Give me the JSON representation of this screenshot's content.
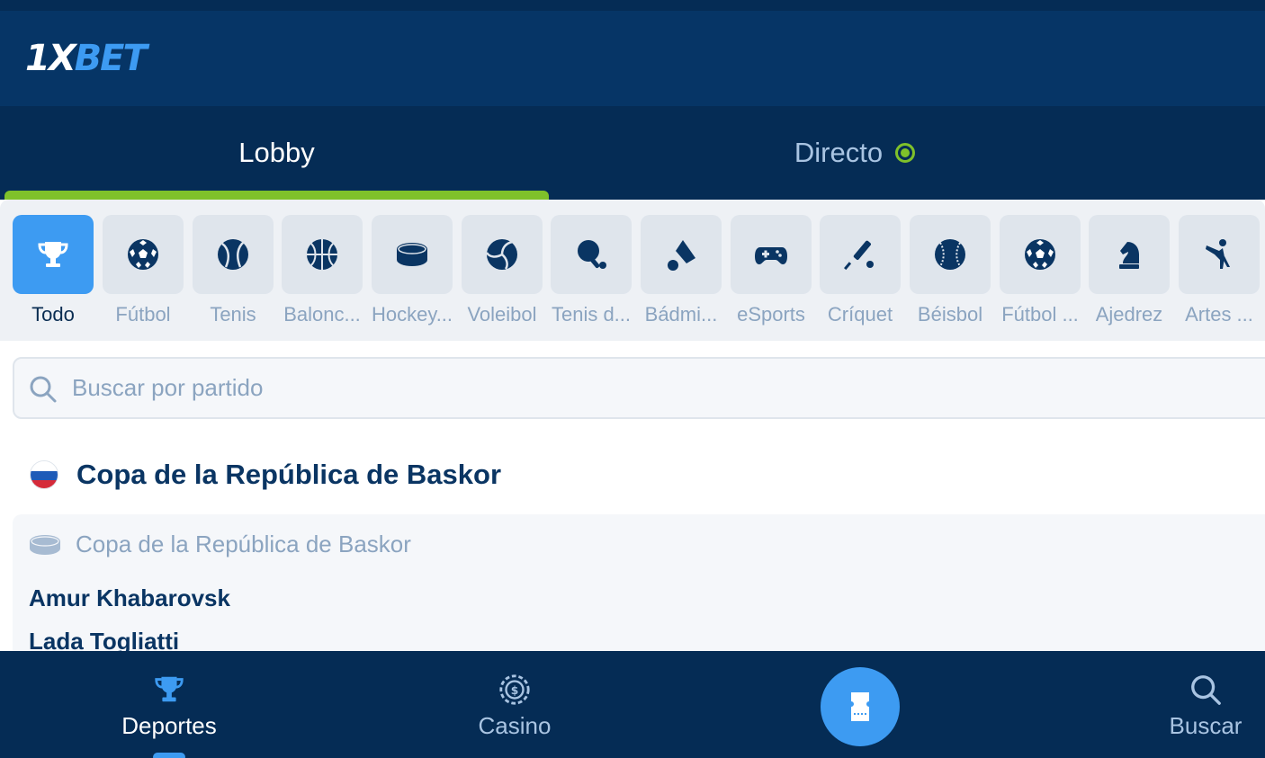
{
  "brand": {
    "logo_part1": "1X",
    "logo_part2": "BET"
  },
  "tabs": [
    {
      "label": "Lobby",
      "active": true
    },
    {
      "label": "Directo",
      "active": false,
      "live_indicator": true
    }
  ],
  "sports": [
    {
      "label": "Todo",
      "icon": "trophy-icon",
      "active": true
    },
    {
      "label": "Fútbol",
      "icon": "soccer-ball-icon"
    },
    {
      "label": "Tenis",
      "icon": "tennis-ball-icon"
    },
    {
      "label": "Balonc...",
      "icon": "basketball-icon"
    },
    {
      "label": "Hockey...",
      "icon": "hockey-puck-icon"
    },
    {
      "label": "Voleibol",
      "icon": "volleyball-icon"
    },
    {
      "label": "Tenis d...",
      "icon": "table-tennis-icon"
    },
    {
      "label": "Bádmi...",
      "icon": "shuttlecock-icon"
    },
    {
      "label": "eSports",
      "icon": "gamepad-icon"
    },
    {
      "label": "Críquet",
      "icon": "cricket-bat-icon"
    },
    {
      "label": "Béisbol",
      "icon": "baseball-icon"
    },
    {
      "label": "Fútbol ...",
      "icon": "soccer-ball-icon"
    },
    {
      "label": "Ajedrez",
      "icon": "chess-knight-icon"
    },
    {
      "label": "Artes ...",
      "icon": "martial-arts-icon"
    }
  ],
  "search": {
    "placeholder": "Buscar por partido"
  },
  "league": {
    "country_flag": "russia-flag",
    "title": "Copa de la República de Baskor"
  },
  "match": {
    "competition": "Copa de la República de Baskor",
    "sport_icon": "hockey-puck-icon",
    "team1": "Amur Khabarovsk",
    "team2": "Lada Togliatti"
  },
  "bottom_nav": {
    "sports_label": "Deportes",
    "casino_label": "Casino",
    "search_label": "Buscar",
    "betslip_icon": "ticket-icon"
  },
  "colors": {
    "header_bg": "#063566",
    "tabs_bg": "#052c55",
    "accent_blue": "#3d9bf2",
    "live_green": "#7fc12a",
    "text_dark": "#0a3563",
    "text_muted": "#8ba4c0"
  }
}
